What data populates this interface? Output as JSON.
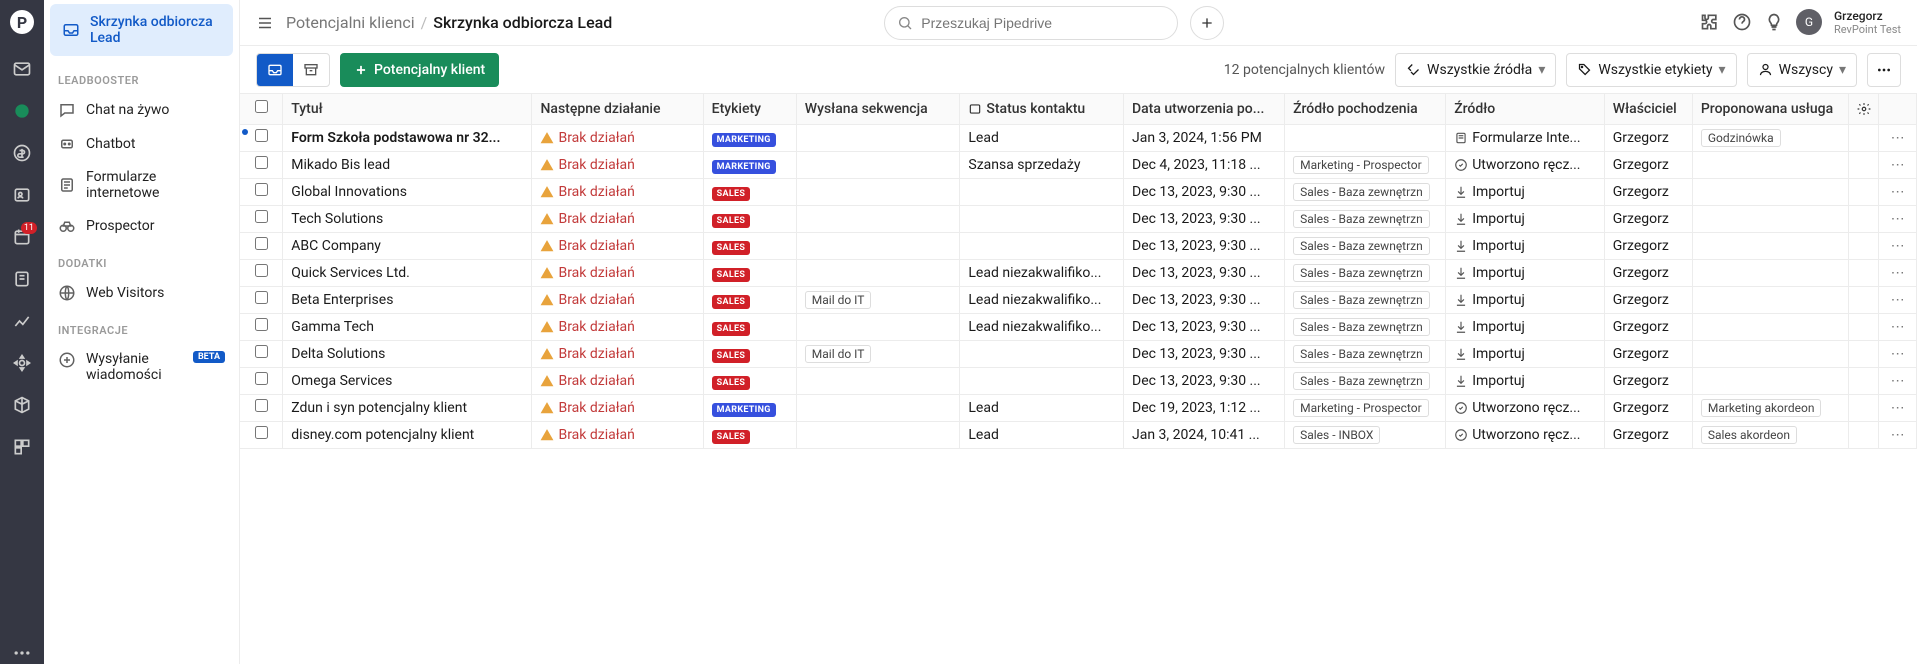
{
  "breadcrumb": {
    "parent": "Potencjalni klienci",
    "current": "Skrzynka odbiorcza Lead"
  },
  "search": {
    "placeholder": "Przeszukaj Pipedrive"
  },
  "user": {
    "initial": "G",
    "name": "Grzegorz",
    "org": "RevPoint Test"
  },
  "sidebar": {
    "inbox": "Skrzynka odbiorcza Lead",
    "sections": {
      "leadbooster": "LEADBOOSTER",
      "addons": "DODATKI",
      "integrations": "INTEGRACJE"
    },
    "items": {
      "chat": "Chat na żywo",
      "chatbot": "Chatbot",
      "forms": "Formularze internetowe",
      "prospector": "Prospector",
      "webvisitors": "Web Visitors",
      "messaging": "Wysyłanie wiadomości"
    },
    "beta": "BETA"
  },
  "toolbar": {
    "primary": "Potencjalny klient",
    "count": "12 potencjalnych klientów",
    "filter_sources": "Wszystkie źródła",
    "filter_labels": "Wszystkie etykiety",
    "filter_owner": "Wszyscy"
  },
  "calendar_badge": "11",
  "columns": {
    "title": "Tytuł",
    "next": "Następne działanie",
    "labels": "Etykiety",
    "seq": "Wysłana sekwencja",
    "status": "Status kontaktu",
    "date": "Data utworzenia po...",
    "origch": "Źródło pochodzenia",
    "source": "Źródło",
    "owner": "Właściciel",
    "service": "Proponowana usługa"
  },
  "labels": {
    "marketing": "MARKETING",
    "sales": "SALES"
  },
  "no_action": "Brak działań",
  "rows": [
    {
      "bold": true,
      "dot": true,
      "title": "Form Szkoła podstawowa nr 32...",
      "label": "marketing",
      "seq": "",
      "status": "Lead",
      "date": "Jan 3, 2024, 1:56 PM",
      "origch": "",
      "source": "Formularze Inte...",
      "source_icon": "form",
      "owner": "Grzegorz",
      "service": "Godzinówka"
    },
    {
      "title": "Mikado Bis lead",
      "label": "marketing",
      "seq": "",
      "status": "Szansa sprzedaży",
      "date": "Dec 4, 2023, 11:18 ...",
      "origch": "Marketing - Prospector",
      "source": "Utworzono ręcz...",
      "source_icon": "manual",
      "owner": "Grzegorz",
      "service": ""
    },
    {
      "title": "Global Innovations",
      "label": "sales",
      "seq": "",
      "status": "",
      "date": "Dec 13, 2023, 9:30 ...",
      "origch": "Sales - Baza zewnętrzn",
      "source": "Importuj",
      "source_icon": "import",
      "owner": "Grzegorz",
      "service": ""
    },
    {
      "title": "Tech Solutions",
      "label": "sales",
      "seq": "",
      "status": "",
      "date": "Dec 13, 2023, 9:30 ...",
      "origch": "Sales - Baza zewnętrzn",
      "source": "Importuj",
      "source_icon": "import",
      "owner": "Grzegorz",
      "service": ""
    },
    {
      "title": "ABC Company",
      "label": "sales",
      "seq": "",
      "status": "",
      "date": "Dec 13, 2023, 9:30 ...",
      "origch": "Sales - Baza zewnętrzn",
      "source": "Importuj",
      "source_icon": "import",
      "owner": "Grzegorz",
      "service": ""
    },
    {
      "title": "Quick Services Ltd.",
      "label": "sales",
      "seq": "",
      "status": "Lead niezakwalifiko...",
      "date": "Dec 13, 2023, 9:30 ...",
      "origch": "Sales - Baza zewnętrzn",
      "source": "Importuj",
      "source_icon": "import",
      "owner": "Grzegorz",
      "service": ""
    },
    {
      "title": "Beta Enterprises",
      "label": "sales",
      "seq": "Mail do IT",
      "status": "Lead niezakwalifiko...",
      "date": "Dec 13, 2023, 9:30 ...",
      "origch": "Sales - Baza zewnętrzn",
      "source": "Importuj",
      "source_icon": "import",
      "owner": "Grzegorz",
      "service": ""
    },
    {
      "title": "Gamma Tech",
      "label": "sales",
      "seq": "",
      "status": "Lead niezakwalifiko...",
      "date": "Dec 13, 2023, 9:30 ...",
      "origch": "Sales - Baza zewnętrzn",
      "source": "Importuj",
      "source_icon": "import",
      "owner": "Grzegorz",
      "service": ""
    },
    {
      "title": "Delta Solutions",
      "label": "sales",
      "seq": "Mail do IT",
      "status": "",
      "date": "Dec 13, 2023, 9:30 ...",
      "origch": "Sales - Baza zewnętrzn",
      "source": "Importuj",
      "source_icon": "import",
      "owner": "Grzegorz",
      "service": ""
    },
    {
      "title": "Omega Services",
      "label": "sales",
      "seq": "",
      "status": "",
      "date": "Dec 13, 2023, 9:30 ...",
      "origch": "Sales - Baza zewnętrzn",
      "source": "Importuj",
      "source_icon": "import",
      "owner": "Grzegorz",
      "service": ""
    },
    {
      "title": "Zdun i syn potencjalny klient",
      "label": "marketing",
      "seq": "",
      "status": "Lead",
      "date": "Dec 19, 2023, 1:12 ...",
      "origch": "Marketing - Prospector",
      "source": "Utworzono ręcz...",
      "source_icon": "manual",
      "owner": "Grzegorz",
      "service": "Marketing akordeon"
    },
    {
      "title": "disney.com potencjalny klient",
      "label": "sales",
      "seq": "",
      "status": "Lead",
      "date": "Jan 3, 2024, 10:41 ...",
      "origch": "Sales - INBOX",
      "source": "Utworzono ręcz...",
      "source_icon": "manual",
      "owner": "Grzegorz",
      "service": "Sales akordeon"
    }
  ]
}
